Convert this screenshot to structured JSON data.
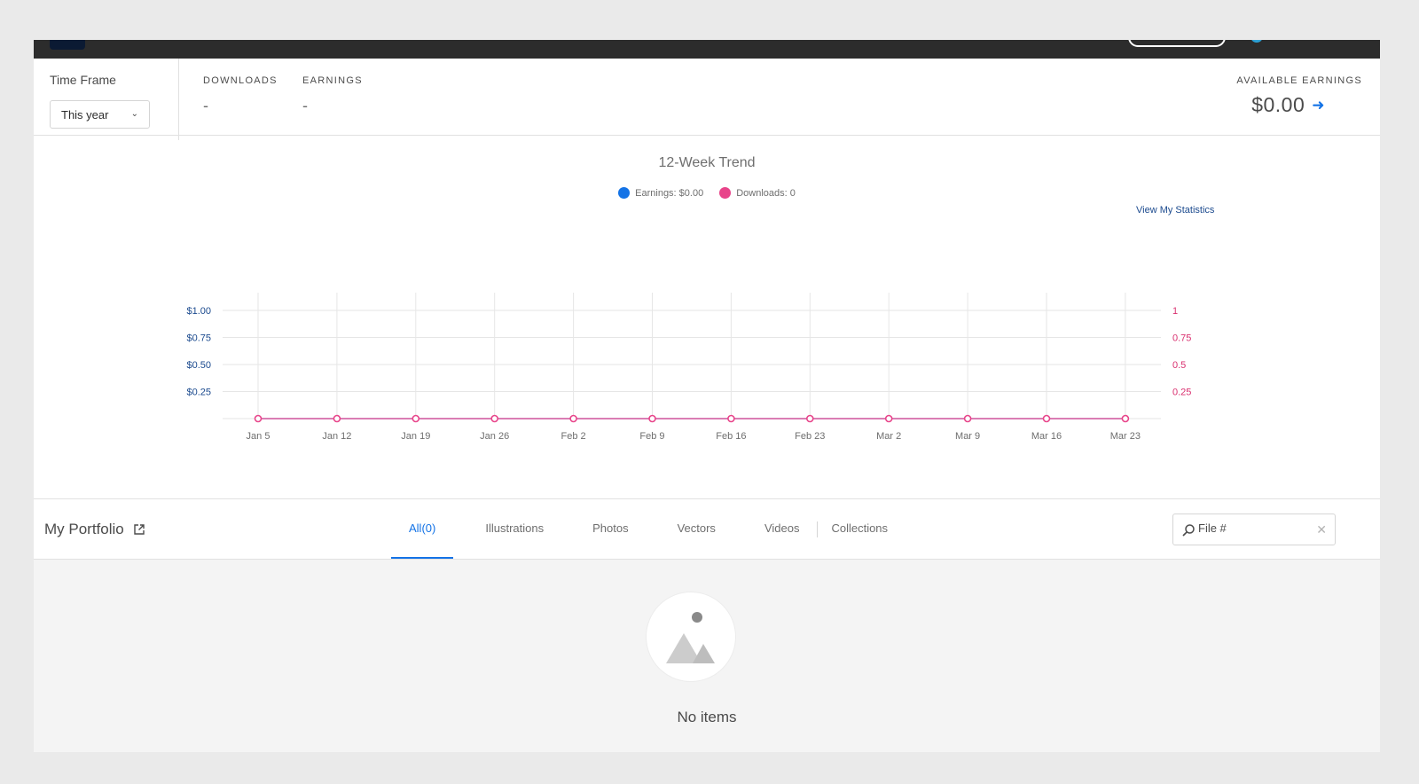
{
  "time_frame": {
    "label": "Time Frame",
    "selected": "This year"
  },
  "metrics": {
    "downloads": {
      "label": "DOWNLOADS",
      "value": "-"
    },
    "earnings": {
      "label": "EARNINGS",
      "value": "-"
    },
    "available_earnings": {
      "label": "AVAILABLE EARNINGS",
      "value": "$0.00"
    }
  },
  "chart": {
    "title": "12-Week Trend",
    "legend_earnings": "Earnings: $0.00",
    "legend_downloads": "Downloads: 0",
    "view_statistics": "View My Statistics"
  },
  "chart_data": {
    "type": "line",
    "title": "12-Week Trend",
    "categories": [
      "Jan 5",
      "Jan 12",
      "Jan 19",
      "Jan 26",
      "Feb 2",
      "Feb 9",
      "Feb 16",
      "Feb 23",
      "Mar 2",
      "Mar 9",
      "Mar 16",
      "Mar 23"
    ],
    "series": [
      {
        "name": "Earnings: $0.00",
        "axis": "left",
        "color": "#1473e6",
        "values": [
          0,
          0,
          0,
          0,
          0,
          0,
          0,
          0,
          0,
          0,
          0,
          0
        ]
      },
      {
        "name": "Downloads: 0",
        "axis": "right",
        "color": "#e8448a",
        "values": [
          0,
          0,
          0,
          0,
          0,
          0,
          0,
          0,
          0,
          0,
          0,
          0
        ]
      }
    ],
    "y_left": {
      "ticks": [
        0.25,
        0.5,
        0.75,
        1
      ],
      "tick_labels": [
        "$0.25",
        "$0.50",
        "$0.75",
        "$1.00"
      ],
      "range": [
        0,
        1
      ]
    },
    "y_right": {
      "ticks": [
        0.25,
        0.5,
        0.75,
        1
      ],
      "tick_labels": [
        "0.25",
        "0.5",
        "0.75",
        "1"
      ],
      "range": [
        0,
        1
      ]
    },
    "grid": true,
    "legend": "top-center"
  },
  "portfolio": {
    "title": "My Portfolio",
    "tabs": [
      "All(0)",
      "Illustrations",
      "Photos",
      "Vectors",
      "Videos",
      "Collections"
    ],
    "search_placeholder": "File #",
    "empty_message": "No items"
  },
  "colors": {
    "accent": "#1473e6",
    "downloads": "#e8448a",
    "earnings_axis": "#1b4a8e",
    "topbar": "#2c2c2c"
  }
}
